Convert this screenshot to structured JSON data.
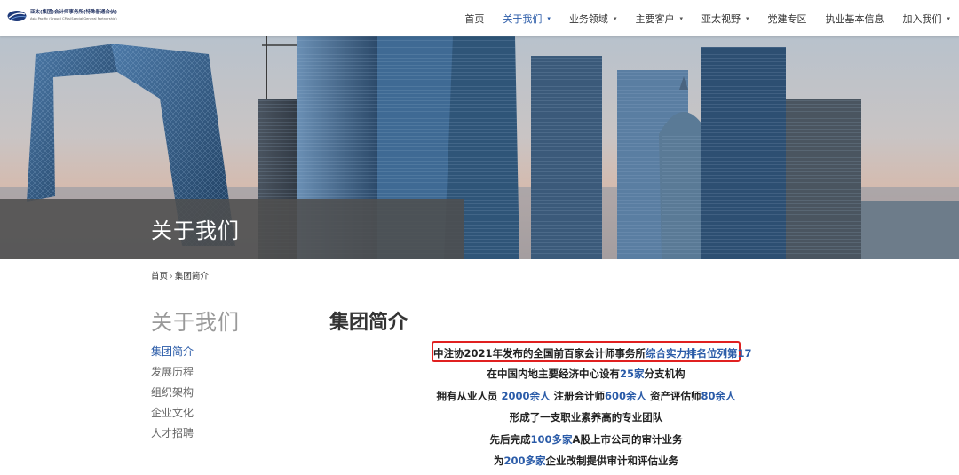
{
  "header": {
    "logo": {
      "name_cn": "亚太(集团)会计师事务所(特殊普通合伙)",
      "name_en": "Asia Pacific (Group) CPAs(Special General Partnership)"
    },
    "nav": [
      {
        "label": "首页",
        "has_dropdown": false,
        "active": false
      },
      {
        "label": "关于我们",
        "has_dropdown": true,
        "active": true
      },
      {
        "label": "业务领域",
        "has_dropdown": true,
        "active": false
      },
      {
        "label": "主要客户",
        "has_dropdown": true,
        "active": false
      },
      {
        "label": "亚太视野",
        "has_dropdown": true,
        "active": false
      },
      {
        "label": "党建专区",
        "has_dropdown": false,
        "active": false
      },
      {
        "label": "执业基本信息",
        "has_dropdown": false,
        "active": false
      },
      {
        "label": "加入我们",
        "has_dropdown": true,
        "active": false
      }
    ],
    "caret": "▾"
  },
  "banner": {
    "title": "关于我们"
  },
  "breadcrumb": {
    "home": "首页",
    "sep": "›",
    "current": "集团简介"
  },
  "sidebar": {
    "title": "关于我们",
    "items": [
      {
        "label": "集团简介",
        "active": true
      },
      {
        "label": "发展历程",
        "active": false
      },
      {
        "label": "组织架构",
        "active": false
      },
      {
        "label": "企业文化",
        "active": false
      },
      {
        "label": "人才招聘",
        "active": false
      }
    ]
  },
  "main": {
    "title": "集团简介",
    "lines": [
      {
        "boxed": true,
        "parts": [
          {
            "t": "中注协2021年发布的全国前百家会计师事务所",
            "hl": false
          },
          {
            "t": "综合实力排名位列第17",
            "hl": true
          }
        ]
      },
      {
        "boxed": false,
        "parts": [
          {
            "t": "在中国内地主要经济中心设有",
            "hl": false
          },
          {
            "t": "25家",
            "hl": true
          },
          {
            "t": "分支机构",
            "hl": false
          }
        ]
      },
      {
        "boxed": false,
        "parts": [
          {
            "t": "拥有从业人员 ",
            "hl": false
          },
          {
            "t": "2000余人",
            "hl": true
          },
          {
            "t": " 注册会计师",
            "hl": false
          },
          {
            "t": "600余人",
            "hl": true
          },
          {
            "t": " 资产评估师",
            "hl": false
          },
          {
            "t": "80余人",
            "hl": true
          }
        ]
      },
      {
        "boxed": false,
        "parts": [
          {
            "t": "形成了一支职业素养高的专业团队",
            "hl": false
          }
        ]
      },
      {
        "boxed": false,
        "parts": [
          {
            "t": "先后完成",
            "hl": false
          },
          {
            "t": "100多家",
            "hl": true
          },
          {
            "t": "A股上市公司的审计业务",
            "hl": false
          }
        ]
      },
      {
        "boxed": false,
        "parts": [
          {
            "t": "为",
            "hl": false
          },
          {
            "t": "200多家",
            "hl": true
          },
          {
            "t": "企业改制提供审计和评估业务",
            "hl": false
          }
        ]
      }
    ]
  },
  "colors": {
    "accent": "#2a5ba8",
    "highlight_box": "#e02020",
    "banner_overlay": "#4e4e4e"
  }
}
